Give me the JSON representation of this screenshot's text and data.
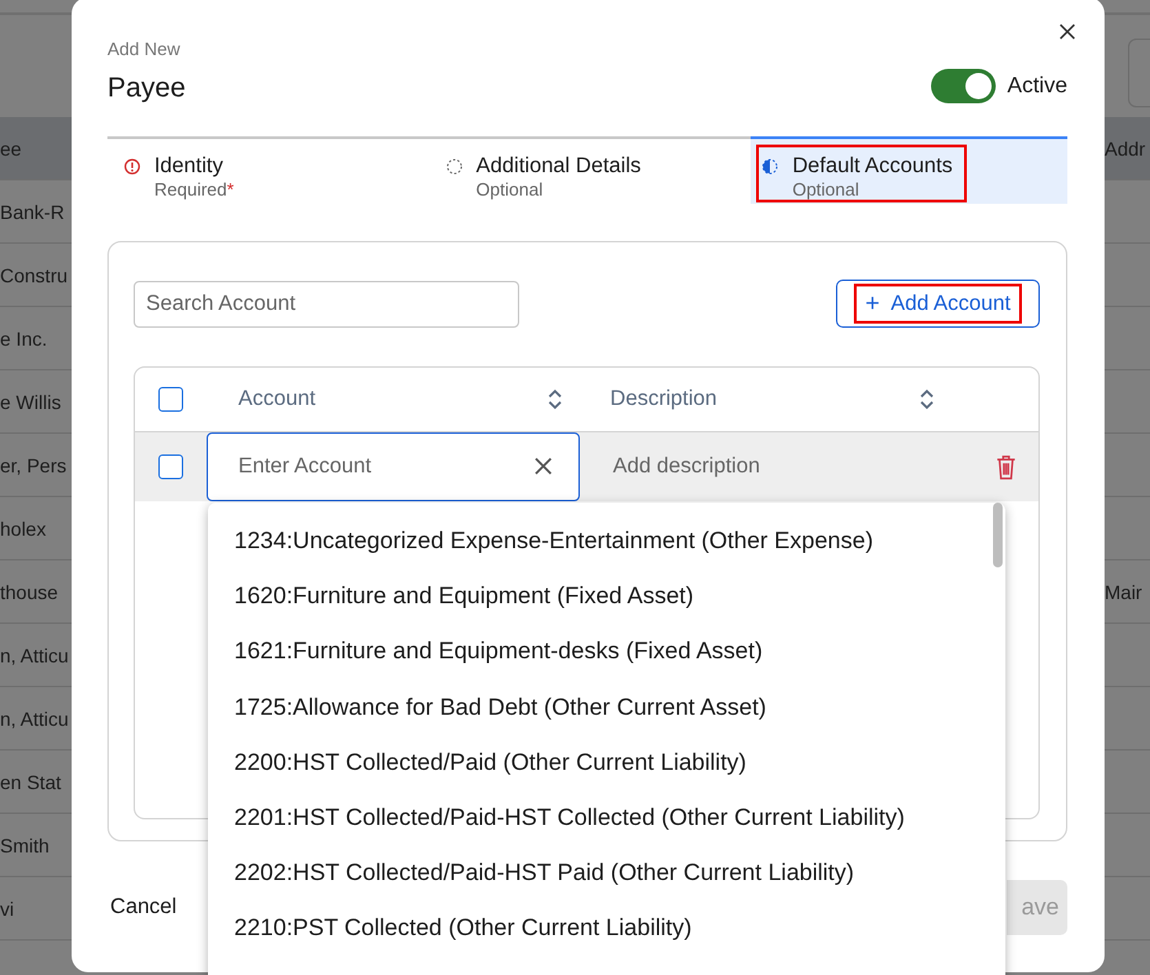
{
  "background": {
    "header": {
      "column_1": "ee",
      "column_2": "Addr"
    },
    "rows": [
      {
        "column_1": "Bank-R"
      },
      {
        "column_1": "Constru"
      },
      {
        "column_1": "e Inc."
      },
      {
        "column_1": "e Willis"
      },
      {
        "column_1": "er, Pers"
      },
      {
        "column_1": "holex"
      },
      {
        "column_1": "thouse",
        "column_2": "Mair"
      },
      {
        "column_1": "n, Atticu"
      },
      {
        "column_1": "n, Atticu"
      },
      {
        "column_1": "en Stat"
      },
      {
        "column_1": "Smith"
      },
      {
        "column_1": "vi"
      }
    ]
  },
  "dialog": {
    "eyebrow": "Add New",
    "title": "Payee",
    "active_toggle": {
      "label": "Active",
      "on": true
    },
    "steps": [
      {
        "kind": "error",
        "title": "Identity",
        "subtitle": "Required",
        "marker": "*",
        "selected": false,
        "highlighted": false
      },
      {
        "kind": "pending",
        "title": "Additional Details",
        "subtitle": "Optional",
        "selected": false,
        "highlighted": false
      },
      {
        "kind": "partial",
        "title": "Default Accounts",
        "subtitle": "Optional",
        "selected": true,
        "highlighted": true
      }
    ],
    "search": {
      "placeholder": "Search Account"
    },
    "add_button": {
      "icon": "+",
      "label": "Add Account",
      "highlighted": true
    },
    "table": {
      "columns": [
        "Account",
        "Description"
      ],
      "header_checked": false,
      "rows": [
        {
          "checked": false,
          "account_placeholder": "Enter Account",
          "description_placeholder": "Add description"
        }
      ]
    },
    "dropdown": {
      "options": [
        "1234:Uncategorized Expense-Entertainment (Other Expense)",
        "1620:Furniture and Equipment (Fixed Asset)",
        "1621:Furniture and Equipment-desks (Fixed Asset)",
        "1725:Allowance for Bad Debt (Other Current Asset)",
        "2200:HST Collected/Paid (Other Current Liability)",
        "2201:HST Collected/Paid-HST Collected (Other Current Liability)",
        "2202:HST Collected/Paid-HST Paid (Other Current Liability)",
        "2210:PST Collected (Other Current Liability)"
      ]
    },
    "footer": {
      "cancel": "Cancel",
      "save": {
        "label": "ave",
        "disabled": true
      }
    }
  }
}
